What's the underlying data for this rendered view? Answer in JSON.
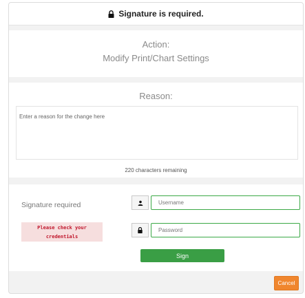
{
  "header": {
    "title": "Signature is required.",
    "icon": "lock-icon"
  },
  "action": {
    "label": "Action:",
    "value": "Modify Print/Chart Settings"
  },
  "reason": {
    "label": "Reason:",
    "placeholder": "Enter a reason for the change here",
    "value": "",
    "counter": "220 characters remaining"
  },
  "signature": {
    "label": "Signature required",
    "error_line1": "Please check your",
    "error_line2": "credentials",
    "username_placeholder": "Username",
    "password_placeholder": "Password",
    "username_icon": "user-icon",
    "password_icon": "lock-icon",
    "sign_label": "Sign"
  },
  "footer": {
    "cancel_label": "Cancel"
  },
  "colors": {
    "accent_green": "#3a9e45",
    "cancel_orange": "#f0862e",
    "error_text": "#c0152b",
    "error_bg": "#f6dede"
  }
}
